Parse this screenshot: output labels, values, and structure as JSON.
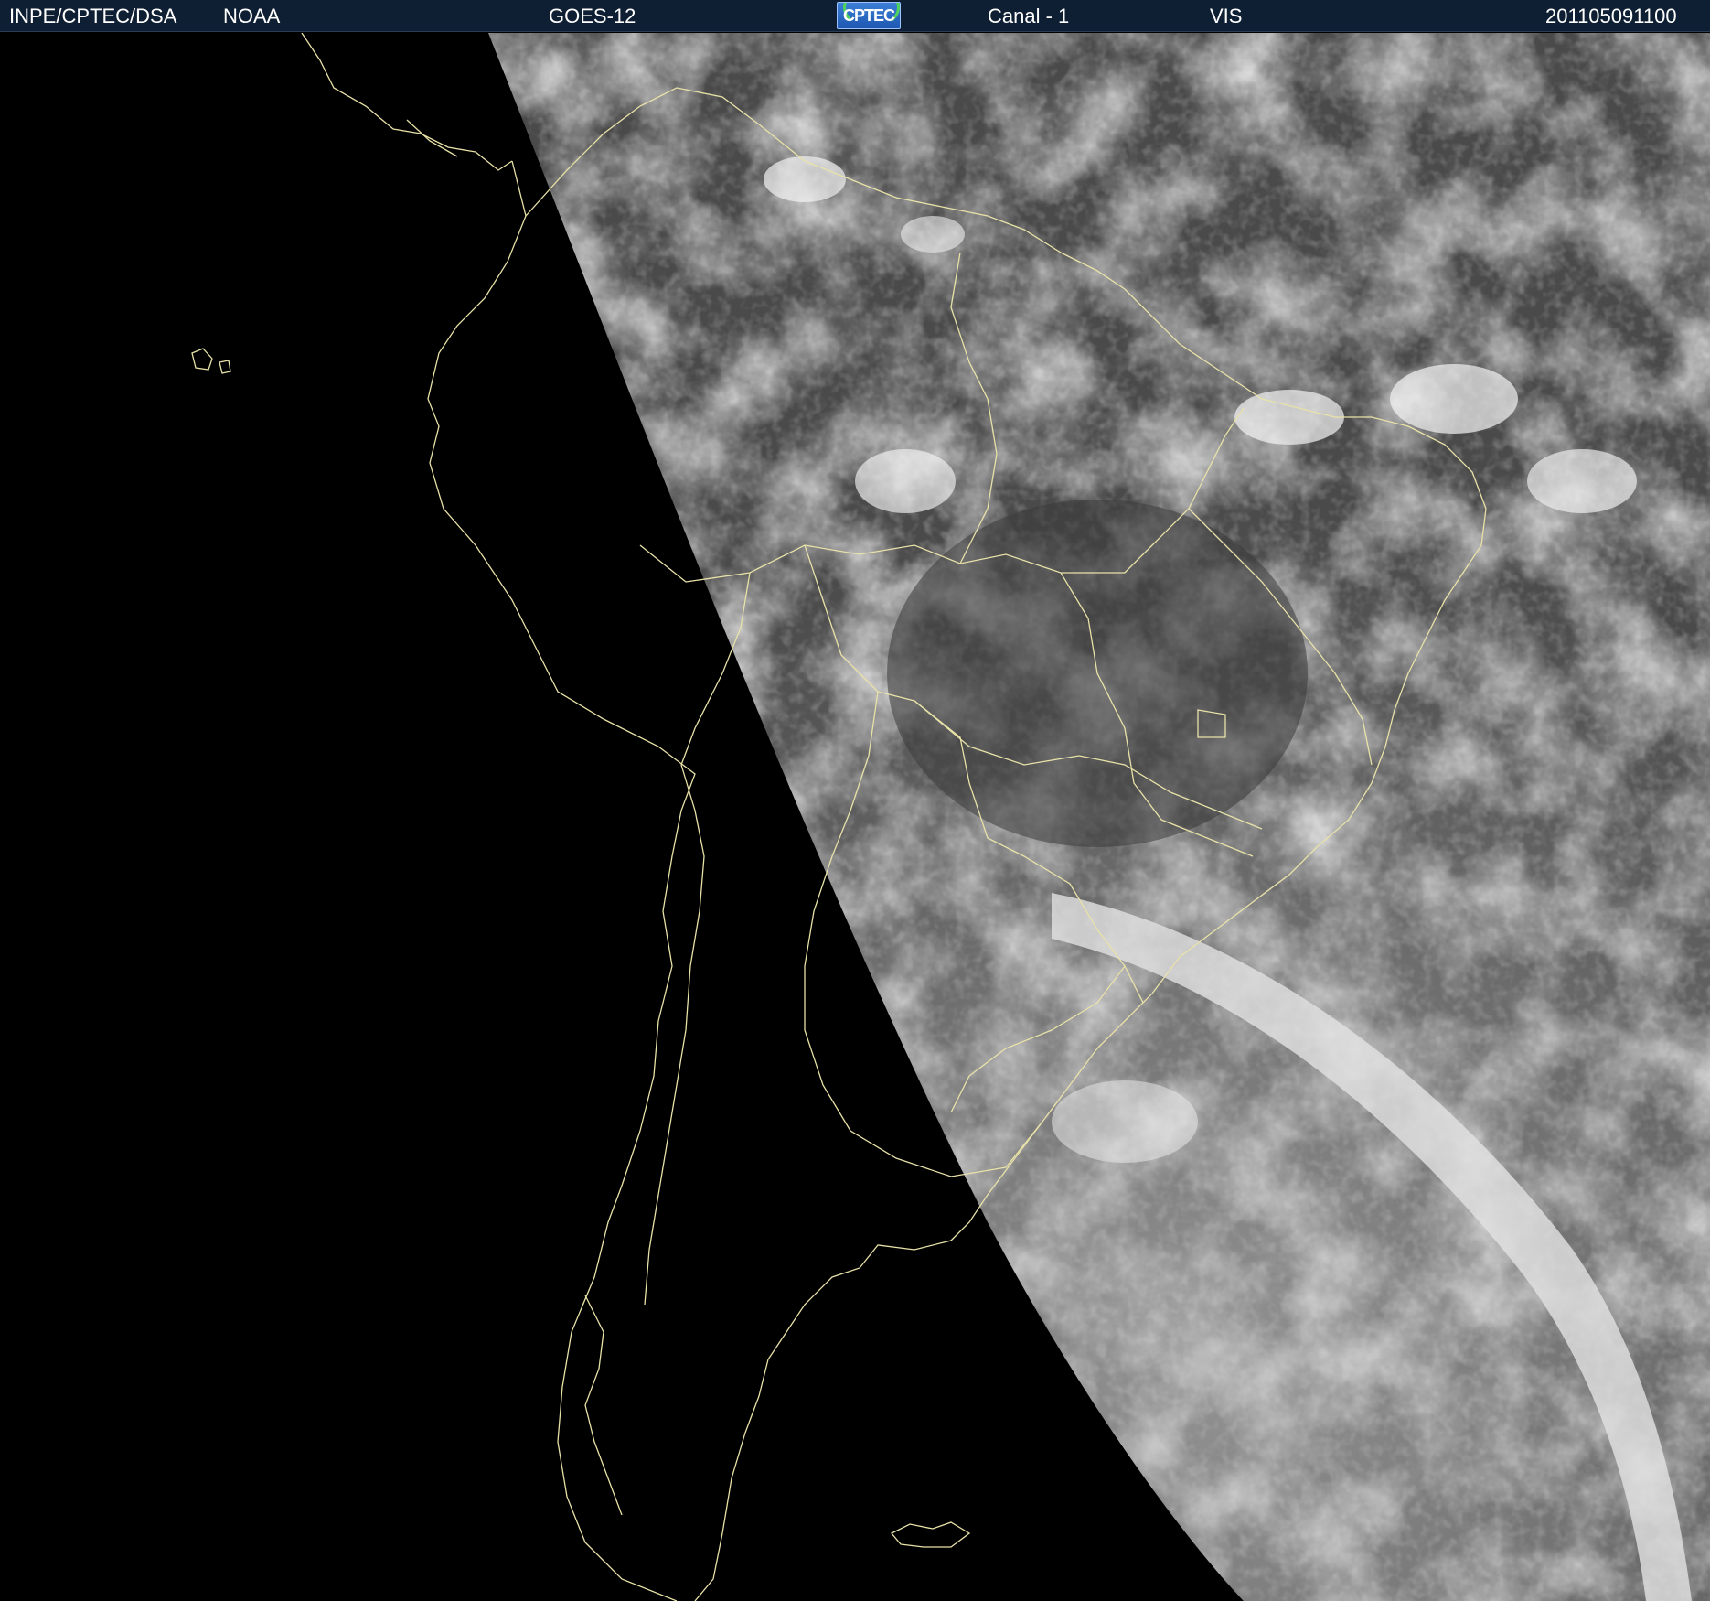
{
  "header": {
    "source": "INPE/CPTEC/DSA",
    "agency": "NOAA",
    "satellite": "GOES-12",
    "logo_text": "CPTEC",
    "channel": "Canal - 1",
    "band": "VIS",
    "timestamp": "201105091100"
  },
  "colors": {
    "header_bg": "#0f1f33",
    "space": "#000000",
    "coastline": "#e8e2a8"
  },
  "icons": {
    "logo": "cptec-logo-icon"
  }
}
